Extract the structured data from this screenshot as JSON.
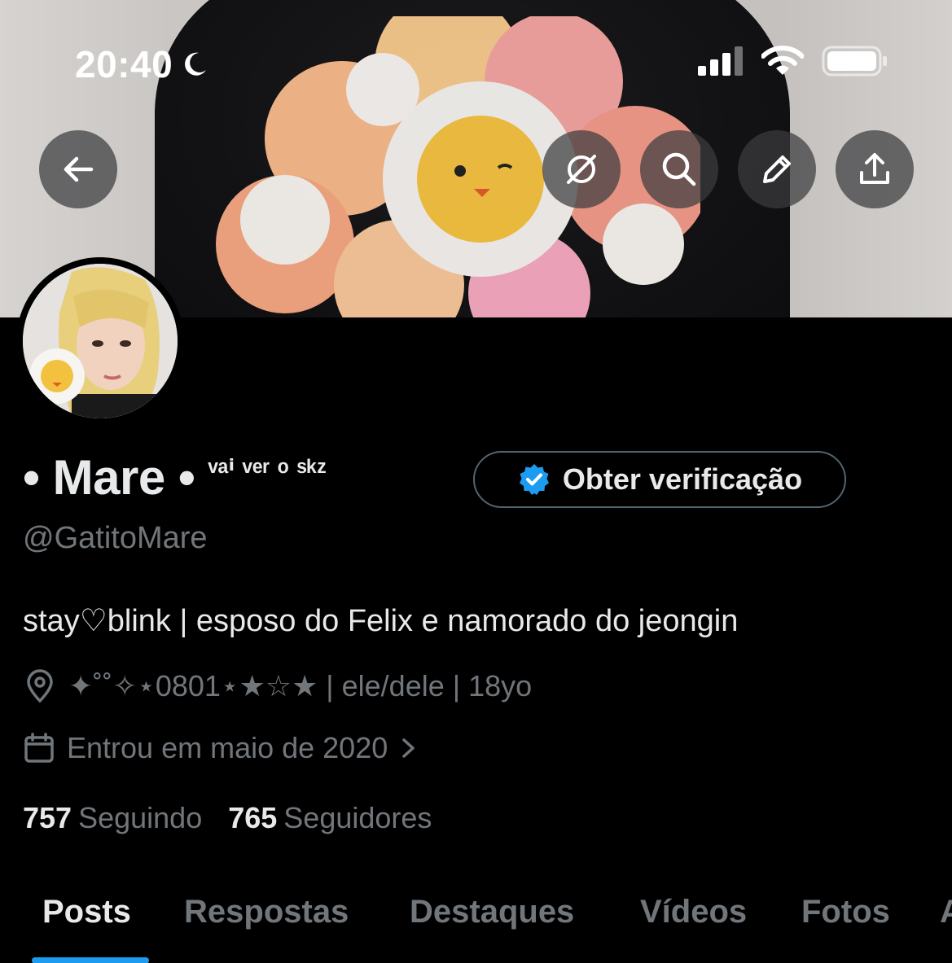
{
  "status_bar": {
    "time": "20:40",
    "icons": [
      "moon-icon",
      "cellular-signal-icon",
      "wifi-icon",
      "battery-icon"
    ]
  },
  "header_buttons": [
    "back-arrow-icon",
    "grok-icon",
    "search-icon",
    "edit-pencil-icon",
    "share-icon"
  ],
  "profile": {
    "name": "• Mare •",
    "name_suffix": "ᵛᵃⁱ ᵛᵉʳ ᵒ ˢᵏᶻ",
    "handle": "@GatitoMare",
    "verify_button": "Obter verificação",
    "bio": "stay♡blink | esposo do Felix e namorado do jeongin",
    "location": "✦˚˚✧⋆0801⋆★☆★ | ele/dele | 18yo",
    "joined": "Entrou em maio de 2020",
    "following_count": "757",
    "following_label": "Seguindo",
    "followers_count": "765",
    "followers_label": "Seguidores"
  },
  "tabs": [
    "Posts",
    "Respostas",
    "Destaques",
    "Vídeos",
    "Fotos",
    "A"
  ],
  "colors": {
    "background": "#000000",
    "text": "#e7e9ea",
    "secondary_text": "#71767b",
    "accent": "#1d9bf0"
  }
}
